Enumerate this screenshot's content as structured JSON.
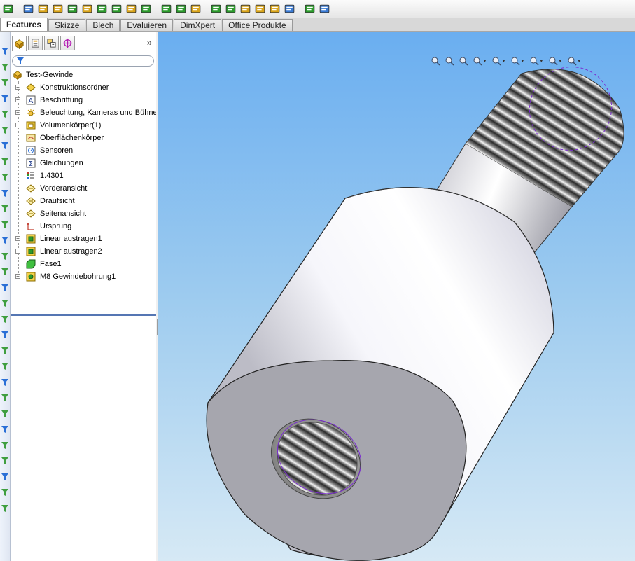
{
  "tabs": [
    {
      "label": "Features",
      "active": true
    },
    {
      "label": "Skizze",
      "active": false
    },
    {
      "label": "Blech",
      "active": false
    },
    {
      "label": "Evaluieren",
      "active": false
    },
    {
      "label": "DimXpert",
      "active": false
    },
    {
      "label": "Office Produkte",
      "active": false
    }
  ],
  "toolbar_icons": [
    "boss-extrude-icon",
    "move-icon",
    "revolve-icon",
    "sweep-icon",
    "cut-extrude-icon",
    "hole-wizard-icon",
    "cut-revolve-icon",
    "cut-sweep-icon",
    "cut-loft-icon",
    "fillet-icon",
    "chamfer-icon",
    "linear-pattern-icon",
    "rib-icon",
    "draft-icon",
    "shell-icon",
    "wrap-icon",
    "dome-icon",
    "intersect-icon",
    "reference-geometry-icon",
    "curves-icon",
    "instant3d-icon"
  ],
  "panel_tabs": [
    "featuremanager-icon",
    "propertymanager-icon",
    "configurationmanager-icon",
    "dimxpert-manager-icon"
  ],
  "colors": {
    "accent": "#5576b3",
    "viewport_top": "#6aaef0",
    "viewport_bottom": "#d6e9f5",
    "sketch_line": "#7a2ccf"
  },
  "tree": {
    "root": "Test-Gewinde",
    "items": [
      {
        "label": "Konstruktionsordner",
        "icon": "annotations-folder-icon",
        "expandable": true
      },
      {
        "label": "Beschriftung",
        "icon": "annotation-icon",
        "expandable": true
      },
      {
        "label": "Beleuchtung, Kameras und Bühne",
        "icon": "lights-icon",
        "expandable": true
      },
      {
        "label": "Volumenkörper(1)",
        "icon": "solid-bodies-icon",
        "expandable": true
      },
      {
        "label": "Oberflächenkörper",
        "icon": "surface-bodies-icon",
        "expandable": false
      },
      {
        "label": "Sensoren",
        "icon": "sensors-icon",
        "expandable": false
      },
      {
        "label": "Gleichungen",
        "icon": "equations-icon",
        "expandable": false
      },
      {
        "label": "1.4301",
        "icon": "material-icon",
        "expandable": false
      },
      {
        "label": "Vorderansicht",
        "icon": "plane-icon",
        "expandable": false
      },
      {
        "label": "Draufsicht",
        "icon": "plane-icon",
        "expandable": false
      },
      {
        "label": "Seitenansicht",
        "icon": "plane-icon",
        "expandable": false
      },
      {
        "label": "Ursprung",
        "icon": "origin-icon",
        "expandable": false
      },
      {
        "label": "Linear austragen1",
        "icon": "extrude-feature-icon",
        "expandable": true
      },
      {
        "label": "Linear austragen2",
        "icon": "extrude-feature-icon",
        "expandable": true
      },
      {
        "label": "Fase1",
        "icon": "chamfer-feature-icon",
        "expandable": false
      },
      {
        "label": "M8 Gewindebohrung1",
        "icon": "hole-feature-icon",
        "expandable": true
      }
    ]
  },
  "viewport_hud": [
    "zoom-to-fit-icon",
    "zoom-area-icon",
    "previous-view-icon",
    "section-view-icon",
    "view-orientation-icon",
    "display-style-icon",
    "hide-show-icon",
    "appearance-icon",
    "scene-icon"
  ]
}
